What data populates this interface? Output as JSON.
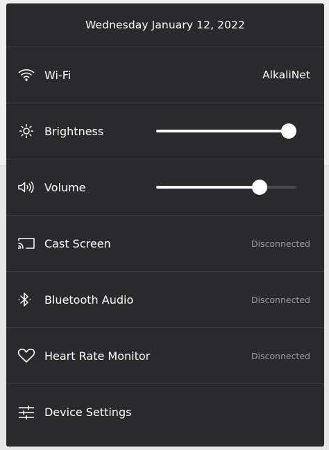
{
  "header": {
    "date": "Wednesday January 12, 2022"
  },
  "rows": {
    "wifi": {
      "label": "Wi-Fi",
      "value": "AlkaliNet",
      "icon": "wifi-icon"
    },
    "brightness": {
      "label": "Brightness",
      "level": 1.0,
      "icon": "brightness-icon"
    },
    "volume": {
      "label": "Volume",
      "level": 0.74,
      "icon": "volume-icon"
    },
    "cast": {
      "label": "Cast Screen",
      "status": "Disconnected",
      "icon": "cast-icon"
    },
    "bluetooth": {
      "label": "Bluetooth Audio",
      "status": "Disconnected",
      "icon": "bluetooth-icon"
    },
    "heart": {
      "label": "Heart Rate Monitor",
      "status": "Disconnected",
      "icon": "heart-icon"
    },
    "settings": {
      "label": "Device Settings",
      "icon": "sliders-icon"
    }
  },
  "colors": {
    "panel": "#2a2a2c",
    "divider": "#3b3b3d",
    "text": "#ffffff",
    "muted": "#9a9a9c",
    "track": "#4a4a4c"
  }
}
